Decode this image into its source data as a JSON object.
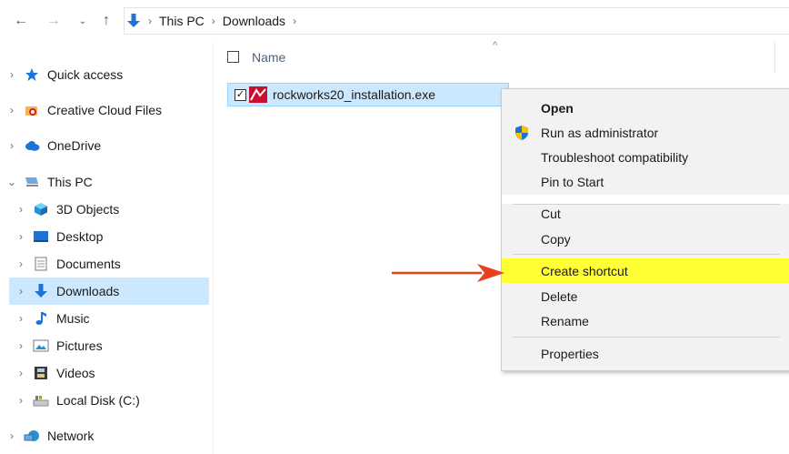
{
  "address_bar": {
    "crumbs": [
      "This PC",
      "Downloads"
    ]
  },
  "sidebar": {
    "items": [
      {
        "label": "Quick access",
        "icon": "star-icon"
      },
      {
        "label": "Creative Cloud Files",
        "icon": "creative-cloud-icon"
      },
      {
        "label": "OneDrive",
        "icon": "cloud-icon"
      },
      {
        "label": "This PC",
        "icon": "computer-icon"
      },
      {
        "label": "3D Objects",
        "icon": "cube-icon"
      },
      {
        "label": "Desktop",
        "icon": "desktop-icon"
      },
      {
        "label": "Documents",
        "icon": "documents-icon"
      },
      {
        "label": "Downloads",
        "icon": "download-arrow-icon"
      },
      {
        "label": "Music",
        "icon": "music-note-icon"
      },
      {
        "label": "Pictures",
        "icon": "pictures-icon"
      },
      {
        "label": "Videos",
        "icon": "film-icon"
      },
      {
        "label": "Local Disk (C:)",
        "icon": "disk-icon"
      },
      {
        "label": "Network",
        "icon": "network-icon"
      }
    ]
  },
  "file_list": {
    "column_name": "Name",
    "files": [
      {
        "name": "rockworks20_installation.exe",
        "selected": true
      }
    ]
  },
  "context_menu": {
    "items": {
      "open": "Open",
      "run_as_admin": "Run as administrator",
      "troubleshoot": "Troubleshoot compatibility",
      "pin_to_start": "Pin to Start",
      "cut": "Cut",
      "copy": "Copy",
      "create_shortcut": "Create shortcut",
      "delete": "Delete",
      "rename": "Rename",
      "properties": "Properties"
    }
  },
  "colors": {
    "selection": "#cce8ff",
    "highlight": "#ffff33",
    "arrow": "#e8401c",
    "accent_blue": "#1e74d6"
  }
}
